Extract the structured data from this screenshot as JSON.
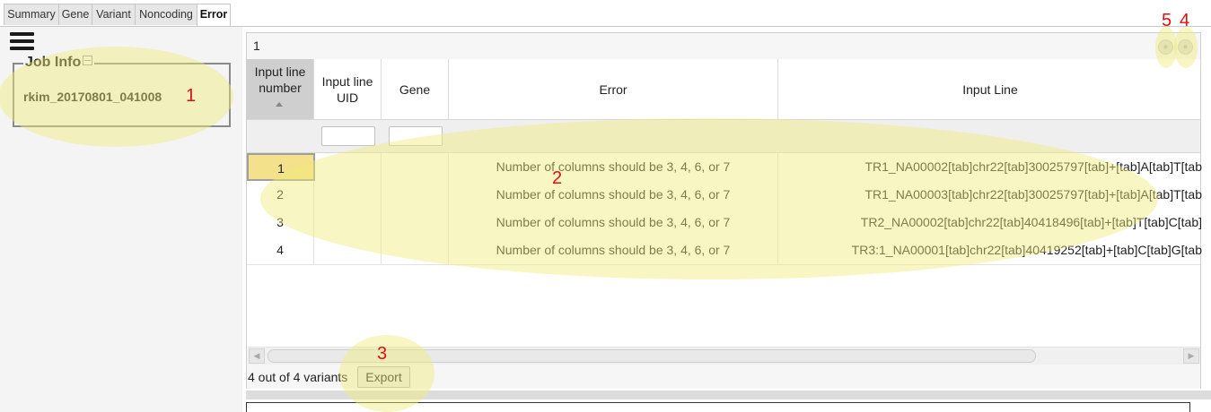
{
  "tabs": [
    {
      "label": "Summary",
      "active": false
    },
    {
      "label": "Gene",
      "active": false
    },
    {
      "label": "Variant",
      "active": false
    },
    {
      "label": "Noncoding",
      "active": false
    },
    {
      "label": "Error",
      "active": true
    }
  ],
  "left_panel": {
    "menu_icon": "hamburger-menu-icon",
    "job_info_title": "Job Info",
    "job_name": "rkim_20170801_041008"
  },
  "grid": {
    "title": "1",
    "columns": [
      "Input line number",
      "Input line UID",
      "Gene",
      "Error",
      "Input Line"
    ],
    "sort_column": "Input line number",
    "sort_direction": "ascending",
    "filter_values": {
      "input_line_uid": "",
      "gene": ""
    },
    "rows": [
      {
        "line_number": "1",
        "uid": "",
        "gene": "",
        "error": "Number of columns should be 3, 4, 6, or 7",
        "input_line": "TR1_NA00002[tab]chr22[tab]30025797[tab]+[tab]A[tab]T[tab"
      },
      {
        "line_number": "2",
        "uid": "",
        "gene": "",
        "error": "Number of columns should be 3, 4, 6, or 7",
        "input_line": "TR1_NA00003[tab]chr22[tab]30025797[tab]+[tab]A[tab]T[tab"
      },
      {
        "line_number": "3",
        "uid": "",
        "gene": "",
        "error": "Number of columns should be 3, 4, 6, or 7",
        "input_line": "TR2_NA00002[tab]chr22[tab]40418496[tab]+[tab]T[tab]C[tab]"
      },
      {
        "line_number": "4",
        "uid": "",
        "gene": "",
        "error": "Number of columns should be 3, 4, 6, or 7",
        "input_line": "TR3:1_NA00001[tab]chr22[tab]40419252[tab]+[tab]C[tab]G[tab"
      }
    ],
    "selected_row": "1",
    "count_label": "4 out of 4 variants",
    "export_label": "Export"
  },
  "annotations": [
    "1",
    "2",
    "3",
    "4",
    "5"
  ],
  "colors": {
    "highlight": "#f0eb78",
    "annotation": "#dd1111",
    "selected_cell": "#f3e28b"
  }
}
